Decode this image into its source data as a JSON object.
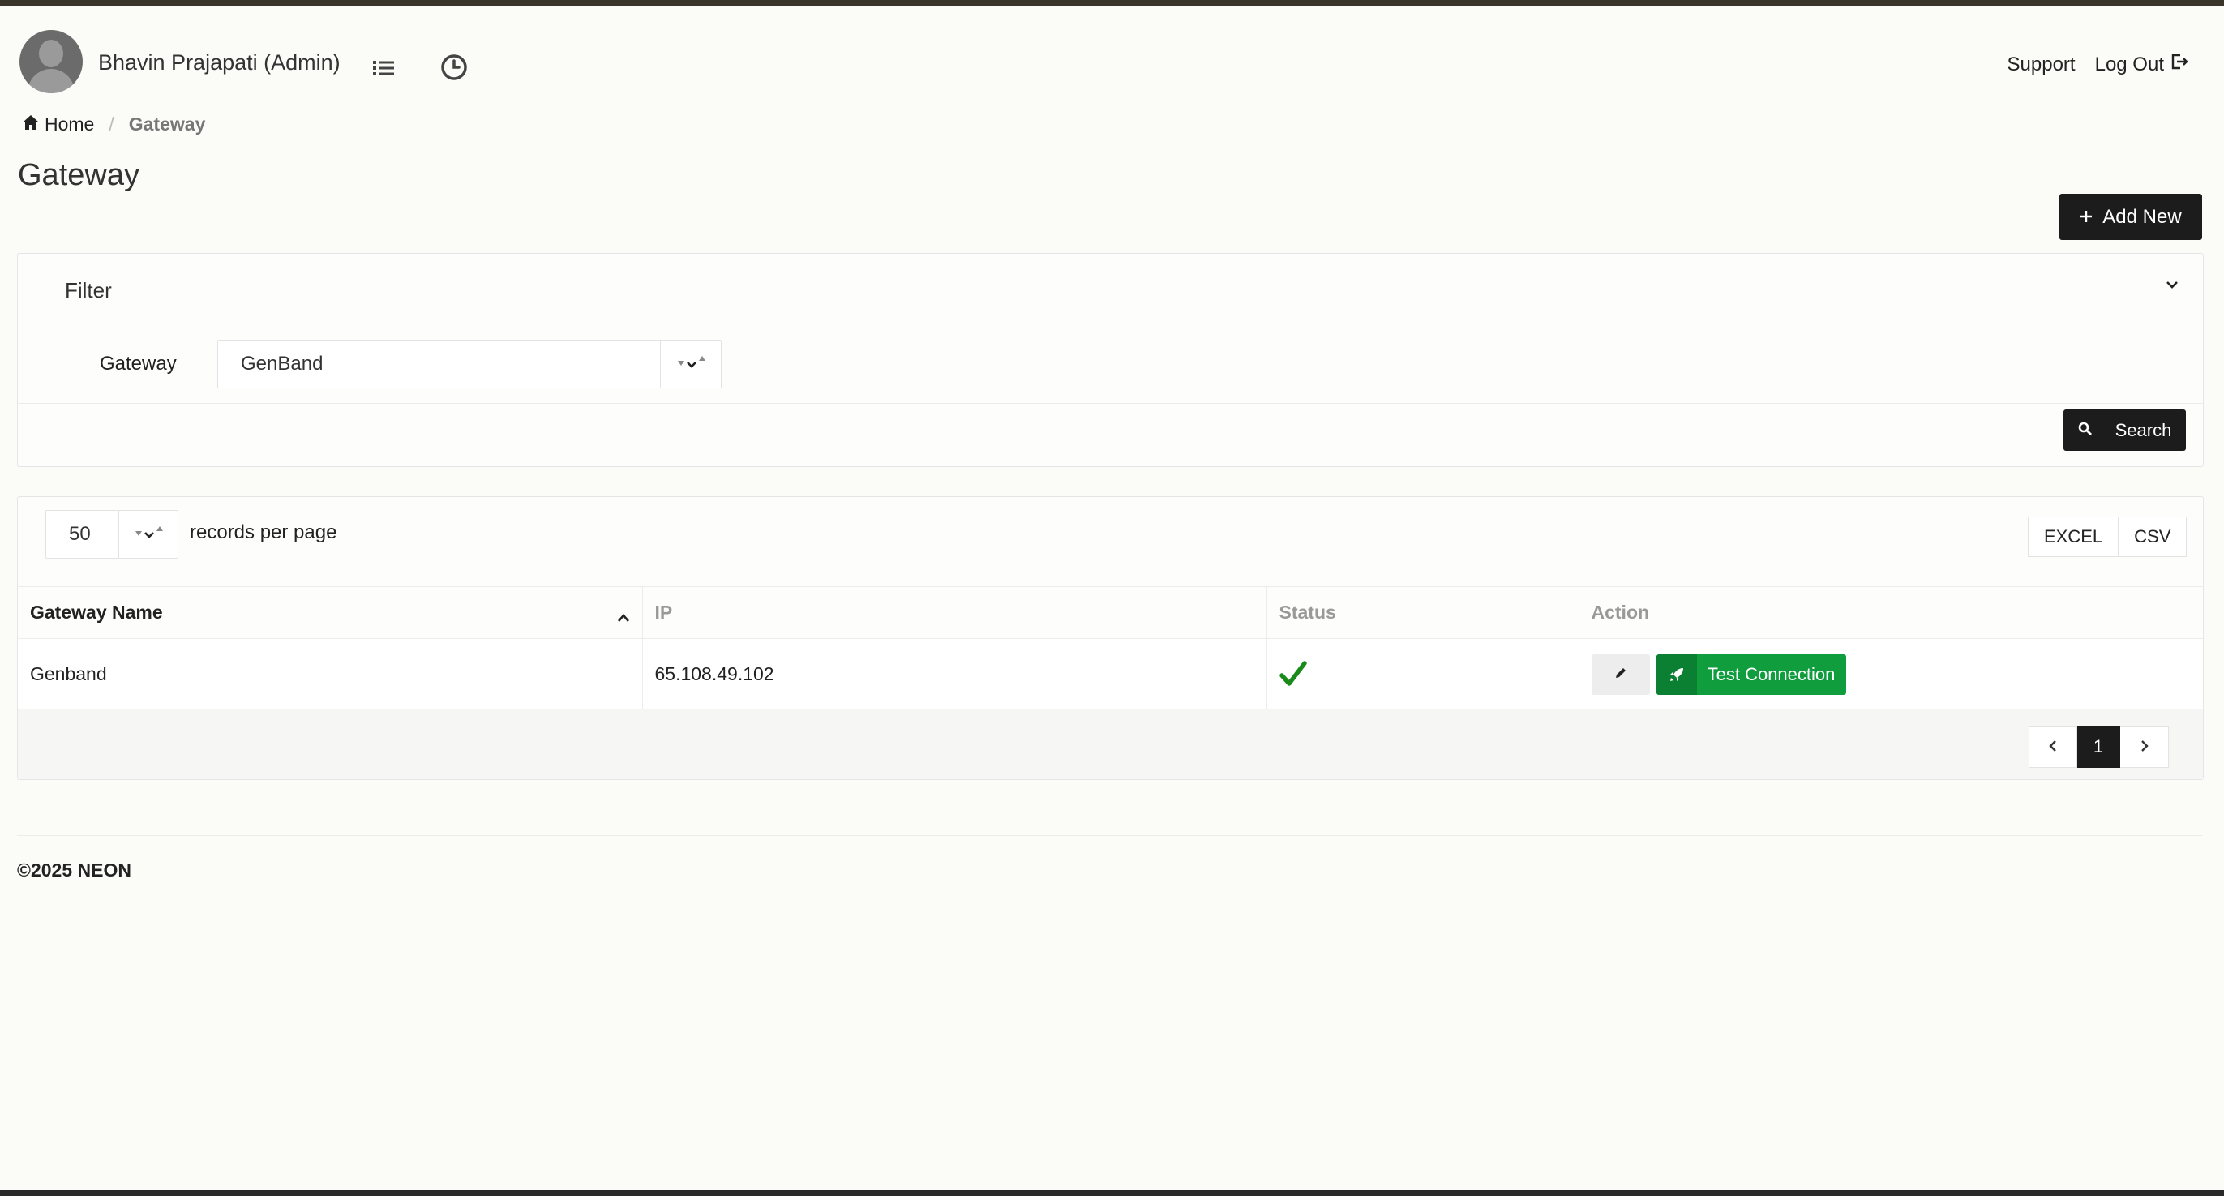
{
  "header": {
    "user_name": "Bhavin Prajapati (Admin)",
    "support_label": "Support",
    "logout_label": "Log Out",
    "icons": [
      "list-icon",
      "history-icon",
      "logout-icon"
    ]
  },
  "breadcrumb": {
    "home_label": "Home",
    "current_label": "Gateway"
  },
  "page": {
    "title": "Gateway",
    "add_new_label": "Add New"
  },
  "filter": {
    "title": "Filter",
    "gateway_label": "Gateway",
    "gateway_value": "GenBand",
    "search_label": "Search"
  },
  "table": {
    "records_per_page_value": "50",
    "records_per_page_label": "records per page",
    "export_excel": "EXCEL",
    "export_csv": "CSV",
    "columns": [
      "Gateway Name",
      "IP",
      "Status",
      "Action"
    ],
    "rows": [
      {
        "gateway_name": "Genband",
        "ip": "65.108.49.102",
        "status": "active",
        "test_label": "Test Connection"
      }
    ],
    "current_page": "1"
  },
  "footer": {
    "text": "©2025 NEON"
  },
  "colors": {
    "accent_dark": "#1c1c1c",
    "success_green": "#0f9d3e",
    "check_green": "#1a8a1a"
  }
}
